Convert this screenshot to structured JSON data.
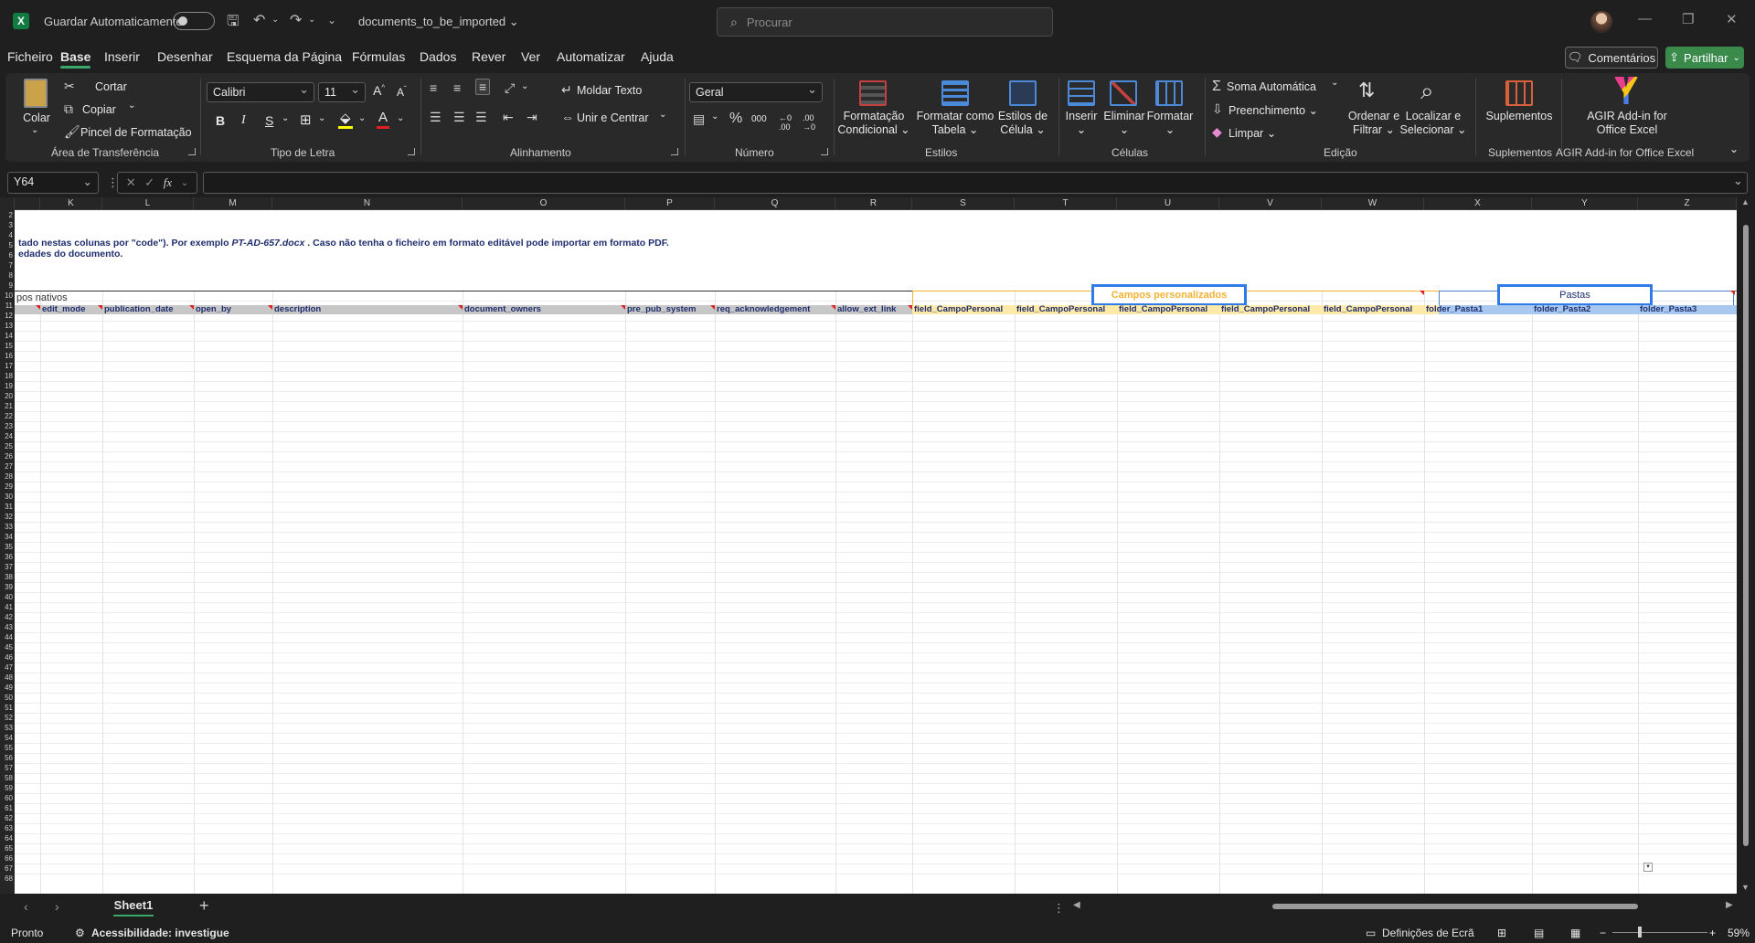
{
  "titlebar": {
    "autosave_label": "Guardar Automaticamente",
    "document_title": "documents_to_be_imported",
    "search_placeholder": "Procurar"
  },
  "menu": {
    "tabs": [
      "Ficheiro",
      "Base",
      "Inserir",
      "Desenhar",
      "Esquema da Página",
      "Fórmulas",
      "Dados",
      "Rever",
      "Ver",
      "Automatizar",
      "Ajuda"
    ],
    "active": "Base",
    "comments_label": "Comentários",
    "share_label": "Partilhar"
  },
  "ribbon": {
    "clipboard": {
      "paste": "Colar",
      "cut": "Cortar",
      "copy": "Copiar",
      "format_painter": "Pincel de Formatação",
      "label": "Área de Transferência"
    },
    "font": {
      "name": "Calibri",
      "size": "11",
      "label": "Tipo de Letra"
    },
    "alignment": {
      "wrap": "Moldar Texto",
      "merge": "Unir e Centrar",
      "label": "Alinhamento"
    },
    "number": {
      "format": "Geral",
      "label": "Número"
    },
    "styles": {
      "conditional": "Formatação Condicional",
      "as_table": "Formatar como Tabela",
      "cell_styles": "Estilos de Célula",
      "label": "Estilos"
    },
    "cells": {
      "insert": "Inserir",
      "delete": "Eliminar",
      "format": "Formatar",
      "label": "Células"
    },
    "editing": {
      "autosum": "Soma Automática",
      "fill": "Preenchimento",
      "clear": "Limpar",
      "sort": "Ordenar e Filtrar",
      "find": "Localizar e Selecionar",
      "label": "Edição"
    },
    "addins": {
      "addins": "Suplementos",
      "label": "Suplementos"
    },
    "agir": {
      "button": "AGIR Add-in for Office Excel",
      "label": "AGIR Add-in for Office Excel"
    }
  },
  "formula_bar": {
    "name_box": "Y64",
    "formula": ""
  },
  "grid": {
    "columns": [
      "K",
      "L",
      "M",
      "N",
      "O",
      "P",
      "Q",
      "R",
      "S",
      "T",
      "U",
      "V",
      "W",
      "X",
      "Y",
      "Z"
    ],
    "info_line_1_pre": "tado nestas colunas por \"code\"). Por exemplo ",
    "info_line_1_italic": "PT-AD-657.docx",
    "info_line_1_post": " . Caso não tenha o ficheiro em formato editável pode importar em formato PDF.",
    "info_line_2": "edades do documento.",
    "section_native": "pos nativos",
    "section_custom": "Campos personalizados",
    "section_folders": "Pastas",
    "fields": [
      "edit_mode",
      "publication_date",
      "open_by",
      "description",
      "document_owners",
      "pre_pub_system",
      "req_acknowledgement",
      "allow_ext_link",
      "field_CampoPersonal",
      "field_CampoPersonal",
      "field_CampoPersonal",
      "field_CampoPersonal",
      "field_CampoPersonal",
      "folder_Pasta1",
      "folder_Pasta2",
      "folder_Pasta3"
    ]
  },
  "sheets": {
    "tabs": [
      "Sheet1"
    ],
    "active": "Sheet1"
  },
  "statusbar": {
    "ready": "Pronto",
    "accessibility": "Acessibilidade: investigue",
    "display_settings": "Definições de Ecrã",
    "zoom": "59%"
  }
}
